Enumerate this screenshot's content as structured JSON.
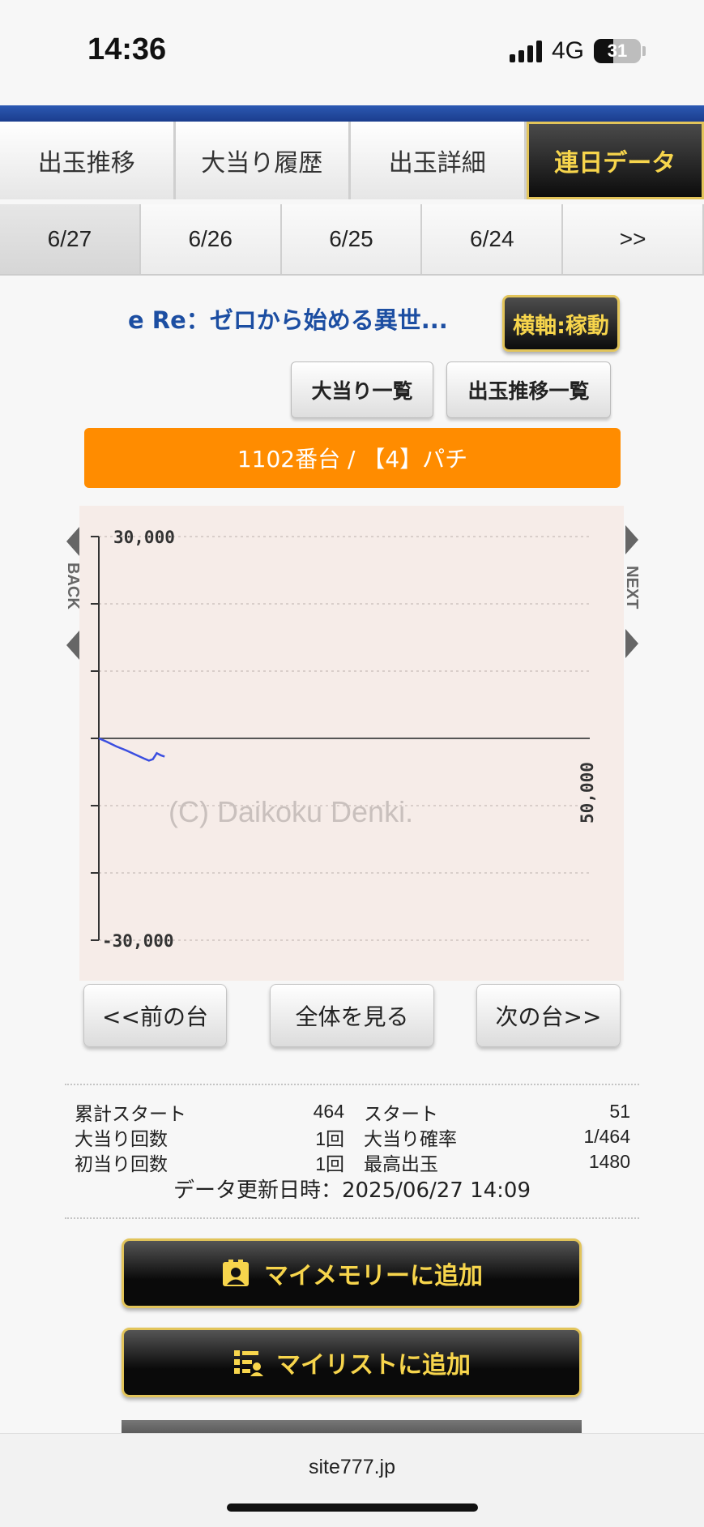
{
  "status": {
    "time": "14:36",
    "network": "4G",
    "battery": "31"
  },
  "tabs": [
    {
      "label": "出玉推移"
    },
    {
      "label": "大当り履歴"
    },
    {
      "label": "出玉詳細"
    },
    {
      "label": "連日データ"
    }
  ],
  "dates": [
    "6/27",
    "6/26",
    "6/25",
    "6/24",
    ">>"
  ],
  "machine": {
    "title": "e Re：ゼロから始める異世...",
    "axis_button": "横軸:稼動"
  },
  "sub_buttons": {
    "jackpot_list": "大当り一覧",
    "trend_list": "出玉推移一覧"
  },
  "unit_bar": "1102番台 / 【4】パチ",
  "chart_data": {
    "type": "line",
    "ylabels": {
      "top": "30,000",
      "bottom": "-30,000"
    },
    "ylim": [
      -30000,
      30000
    ],
    "xlim": [
      0,
      50000
    ],
    "x_end_label": "50,000",
    "watermark": "(C) Daikoku Denki.",
    "side_left": "BACK",
    "side_right": "NEXT",
    "line_color": "#3b4ee0",
    "points": [
      [
        0,
        0
      ],
      [
        800,
        -500
      ],
      [
        1800,
        -1200
      ],
      [
        2800,
        -1800
      ],
      [
        3700,
        -2400
      ],
      [
        4600,
        -3000
      ],
      [
        5100,
        -3300
      ],
      [
        5500,
        -3100
      ],
      [
        5900,
        -2200
      ],
      [
        6300,
        -2500
      ],
      [
        6700,
        -2700
      ]
    ]
  },
  "nav": {
    "prev": "<<前の台",
    "all": "全体を見る",
    "next": "次の台>>"
  },
  "stats": [
    {
      "label": "累計スタート",
      "value": "464",
      "label2": "スタート",
      "value2": "51"
    },
    {
      "label": "大当り回数",
      "value": "1回",
      "label2": "大当り確率",
      "value2": "1/464"
    },
    {
      "label": "初当り回数",
      "value": "1回",
      "label2": "最高出玉",
      "value2": "1480"
    }
  ],
  "updated": "データ更新日時：2025/06/27 14:09",
  "actions": {
    "memory": "マイメモリーに追加",
    "list": "マイリストに追加"
  },
  "url": "site777.jp"
}
